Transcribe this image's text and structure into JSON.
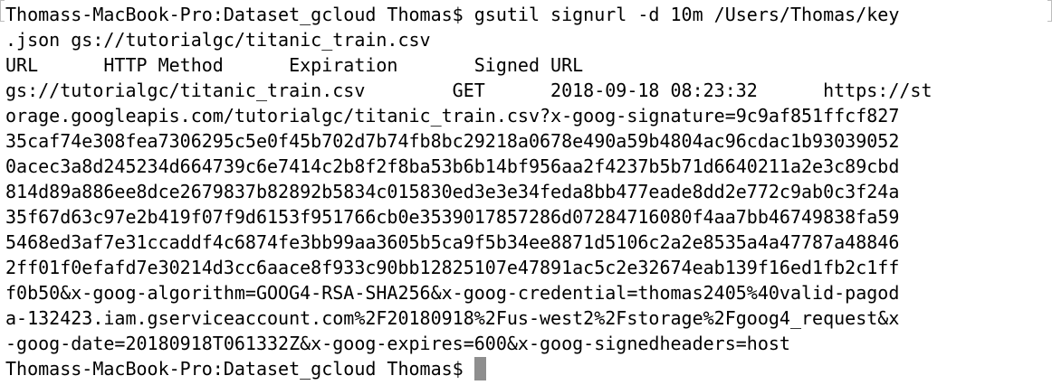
{
  "terminal": {
    "lines": [
      "Thomass-MacBook-Pro:Dataset_gcloud Thomas$ gsutil signurl -d 10m /Users/Thomas/key",
      ".json gs://tutorialgc/titanic_train.csv",
      "URL      HTTP Method      Expiration       Signed URL",
      "gs://tutorialgc/titanic_train.csv        GET      2018-09-18 08:23:32      https://st",
      "orage.googleapis.com/tutorialgc/titanic_train.csv?x-goog-signature=9c9af851ffcf827",
      "35caf74e308fea7306295c5e0f45b702d7b74fb8bc29218a0678e490a59b4804ac96cdac1b93039052",
      "0acec3a8d245234d664739c6e7414c2b8f2f8ba53b6b14bf956aa2f4237b5b71d6640211a2e3c89cbd",
      "814d89a886ee8dce2679837b82892b5834c015830ed3e3e34feda8bb477eade8dd2e772c9ab0c3f24a",
      "35f67d63c97e2b419f07f9d6153f951766cb0e3539017857286d07284716080f4aa7bb46749838fa59",
      "5468ed3af7e31ccaddf4c6874fe3bb99aa3605b5ca9f5b34ee8871d5106c2a2e8535a4a47787a48846",
      "2ff01f0efafd7e30214d3cc6aace8f933c90bb12825107e47891ac5c2e32674eab139f16ed1fb2c1ff",
      "f0b50&x-goog-algorithm=GOOG4-RSA-SHA256&x-goog-credential=thomas2405%40valid-pagod",
      "a-132423.iam.gserviceaccount.com%2F20180918%2Fus-west2%2Fstorage%2Fgoog4_request&x",
      "-goog-date=20180918T061332Z&x-goog-expires=600&x-goog-signedheaders=host"
    ],
    "prompt": "Thomass-MacBook-Pro:Dataset_gcloud Thomas$ ",
    "colors": {
      "background": "#ffffff",
      "text": "#000000",
      "cursor": "#8e8e8e"
    }
  }
}
